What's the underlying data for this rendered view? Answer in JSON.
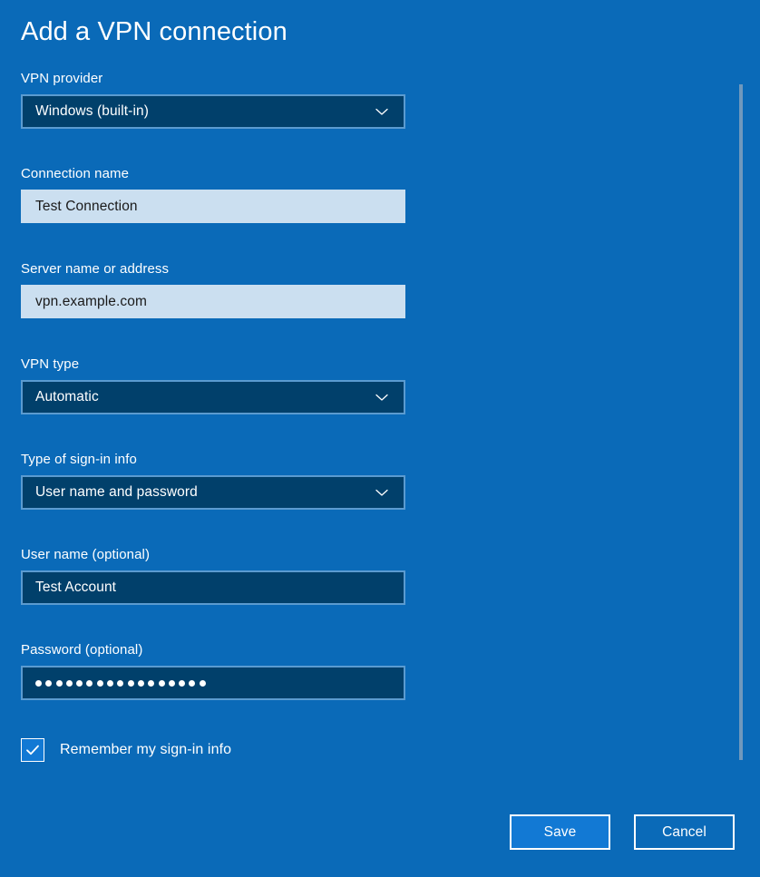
{
  "page": {
    "title": "Add a VPN connection"
  },
  "fields": {
    "vpn_provider": {
      "label": "VPN provider",
      "value": "Windows (built-in)",
      "icon": "chevron-down-icon"
    },
    "connection_name": {
      "label": "Connection name",
      "value": "Test Connection",
      "placeholder": ""
    },
    "server_name": {
      "label": "Server name or address",
      "value": "vpn.example.com",
      "placeholder": ""
    },
    "vpn_type": {
      "label": "VPN type",
      "value": "Automatic",
      "icon": "chevron-down-icon"
    },
    "sign_in_type": {
      "label": "Type of sign-in info",
      "value": "User name and password",
      "icon": "chevron-down-icon"
    },
    "user_name": {
      "label": "User name (optional)",
      "value": "Test Account",
      "placeholder": ""
    },
    "password": {
      "label": "Password (optional)",
      "value": "",
      "masked": true,
      "mask_char_count": 17,
      "placeholder": ""
    }
  },
  "checkbox": {
    "label": "Remember my sign-in info",
    "checked": true
  },
  "buttons": {
    "save": "Save",
    "cancel": "Cancel"
  },
  "colors": {
    "background": "#0a6ab8",
    "field_dark": "#01406b",
    "field_dark_border": "#5b9bd0",
    "field_light": "#cbdff0",
    "accent": "#1279d4",
    "text": "#ffffff",
    "text_dark": "#1a1a1a",
    "scrollbar": "#6f98bd"
  }
}
